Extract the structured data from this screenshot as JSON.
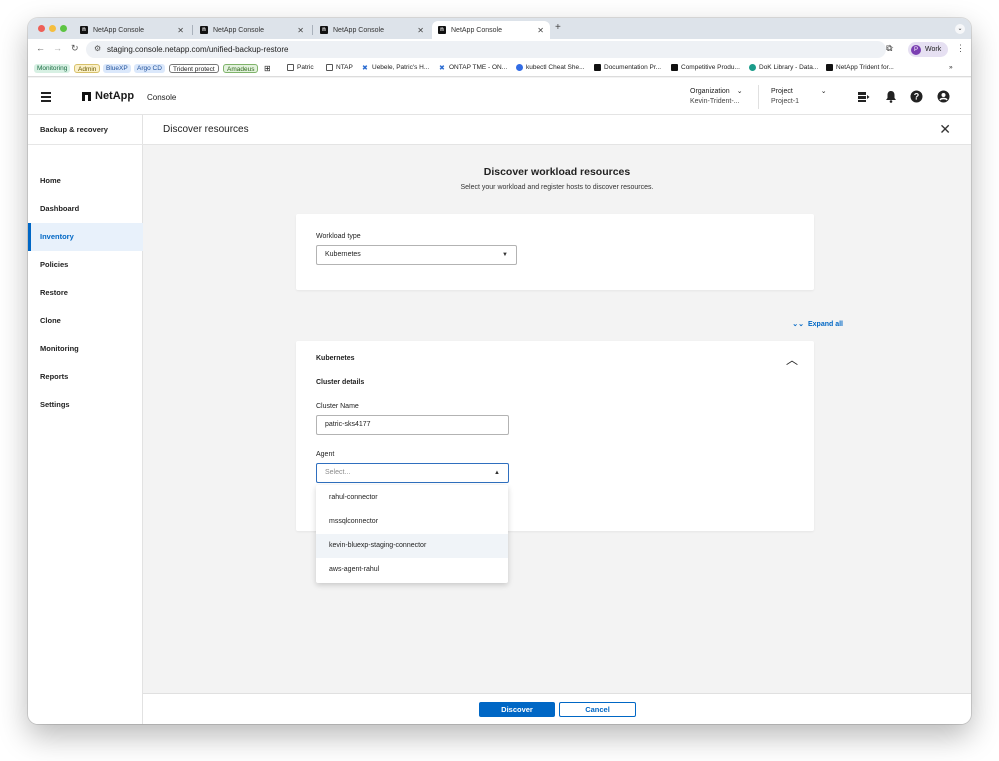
{
  "browser": {
    "tabs": [
      {
        "title": "NetApp Console"
      },
      {
        "title": "NetApp Console"
      },
      {
        "title": "NetApp Console"
      },
      {
        "title": "NetApp Console"
      }
    ],
    "url": "staging.console.netapp.com/unified-backup-restore",
    "profile_label": "Work",
    "profile_initial": "P",
    "bookmarks": [
      "Monitoring",
      "Admin",
      "BlueXP",
      "Argo CD",
      "Trident protect",
      "Amadeus",
      "Patric",
      "NTAP",
      "Uebele, Patric's H...",
      "ONTAP TME - ON...",
      "kubectl Cheat She...",
      "Documentation Pr...",
      "Competitive Produ...",
      "DoK Library - Data...",
      "NetApp Trident for..."
    ],
    "bookmarks_more": "»"
  },
  "app": {
    "brand": "NetApp",
    "product": "Console",
    "organization_label": "Organization",
    "organization_value": "Kevin-Trident-...",
    "project_label": "Project",
    "project_value": "Project-1"
  },
  "sidebar": {
    "title": "Backup & recovery",
    "items": [
      {
        "label": "Home"
      },
      {
        "label": "Dashboard"
      },
      {
        "label": "Inventory"
      },
      {
        "label": "Policies"
      },
      {
        "label": "Restore"
      },
      {
        "label": "Clone"
      },
      {
        "label": "Monitoring"
      },
      {
        "label": "Reports"
      },
      {
        "label": "Settings"
      }
    ],
    "active": "Inventory"
  },
  "panel": {
    "title": "Discover resources",
    "heading": "Discover workload resources",
    "subheading": "Select your workload and register hosts to discover resources.",
    "workload_type_label": "Workload type",
    "workload_type_value": "Kubernetes",
    "expand_all": "Expand all",
    "section_title": "Kubernetes",
    "cluster_details_label": "Cluster details",
    "cluster_name_label": "Cluster Name",
    "cluster_name_value": "patric-sks4177",
    "agent_label": "Agent",
    "agent_placeholder": "Select...",
    "agent_options": [
      "rahul-connector",
      "mssqlconnector",
      "kevin-bluexp-staging-connector",
      "aws-agent-rahul"
    ],
    "agent_hovered": "kevin-bluexp-staging-connector"
  },
  "footer": {
    "discover_label": "Discover",
    "cancel_label": "Cancel"
  },
  "colors": {
    "accent": "#0067c5",
    "active_bg": "#e8f1fb"
  }
}
